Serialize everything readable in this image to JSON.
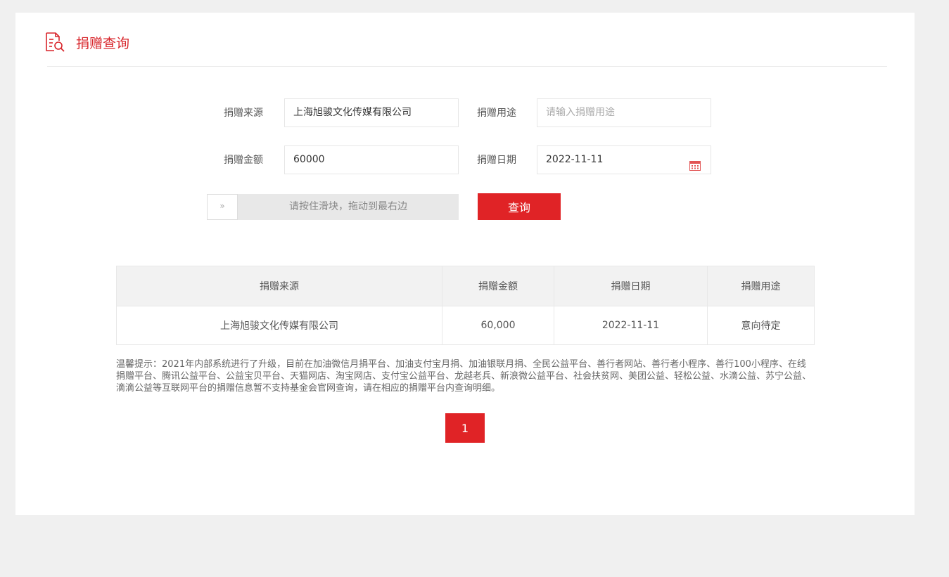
{
  "header": {
    "title": "捐赠查询",
    "icon": "document-search-icon",
    "accent_color": "#d8252b"
  },
  "form": {
    "source_label": "捐赠来源",
    "source_value": "上海旭骏文化传媒有限公司",
    "purpose_label": "捐赠用途",
    "purpose_placeholder": "请输入捐赠用途",
    "amount_label": "捐赠金额",
    "amount_value": "60000",
    "date_label": "捐赠日期",
    "date_value": "2022-11-11",
    "date_icon": "calendar-icon",
    "slider_handle": "»",
    "slider_hint": "请按住滑块，拖动到最右边",
    "query_button": "查询"
  },
  "table": {
    "headers": [
      "捐赠来源",
      "捐赠金额",
      "捐赠日期",
      "捐赠用途"
    ],
    "rows": [
      [
        "上海旭骏文化传媒有限公司",
        "60,000",
        "2022-11-11",
        "意向待定"
      ]
    ]
  },
  "notice": "温馨提示：2021年内部系统进行了升级，目前在加油微信月捐平台、加油支付宝月捐、加油银联月捐、全民公益平台、善行者网站、善行者小程序、善行100小程序、在线捐赠平台、腾讯公益平台、公益宝贝平台、天猫网店、淘宝网店、支付宝公益平台、龙越老兵、新浪微公益平台、社会扶贫网、美团公益、轻松公益、水滴公益、苏宁公益、滴滴公益等互联网平台的捐赠信息暂不支持基金会官网查询，请在相应的捐赠平台内查询明细。",
  "pagination": {
    "current": "1"
  },
  "colors": {
    "primary": "#e02326",
    "background": "#f0f0f0"
  }
}
